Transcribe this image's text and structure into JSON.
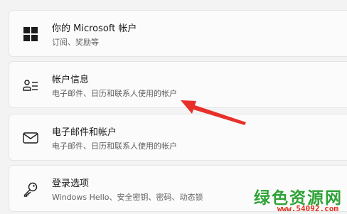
{
  "settings_items": [
    {
      "icon": "windows-logo-icon",
      "title": "你的 Microsoft 帐户",
      "subtitle": "订阅、奖励等"
    },
    {
      "icon": "account-info-icon",
      "title": "帐户信息",
      "subtitle": "电子邮件、日历和联系人使用的帐户"
    },
    {
      "icon": "mail-icon",
      "title": "电子邮件和帐户",
      "subtitle": "电子邮件、日历和联系人使用的帐户"
    },
    {
      "icon": "key-icon",
      "title": "登录选项",
      "subtitle": "Windows Hello、安全密钥、密码、动态锁"
    }
  ],
  "annotation": {
    "arrow_color": "#e8302a"
  },
  "watermark": {
    "title": "绿色资源网",
    "url": "www.54092.com"
  }
}
